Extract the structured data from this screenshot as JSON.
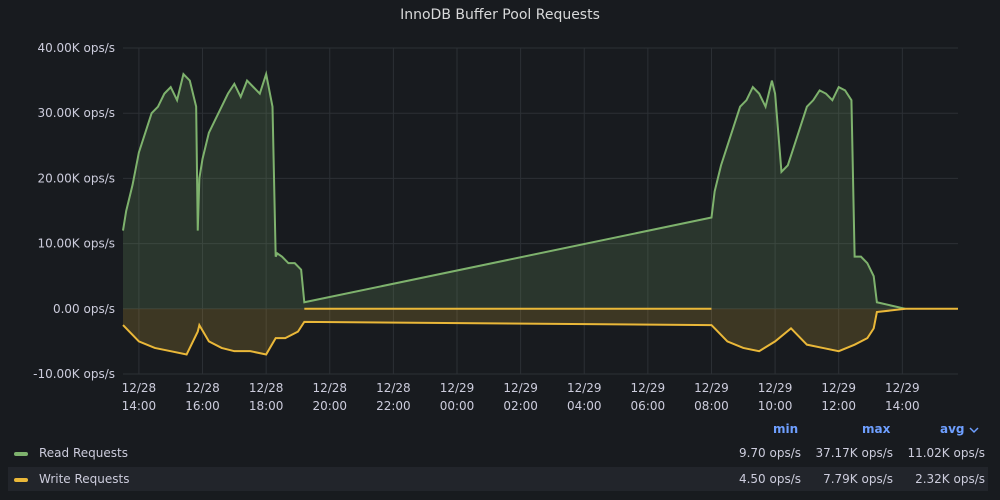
{
  "panel": {
    "title": "InnoDB Buffer Pool Requests"
  },
  "legend": {
    "headers": {
      "min": "min",
      "max": "max",
      "avg": "avg",
      "sort_icon": "chevron-down-icon"
    },
    "rows": [
      {
        "name": "Read Requests",
        "color": "#7eb26d",
        "min": "9.70 ops/s",
        "max": "37.17K ops/s",
        "avg": "11.02K ops/s"
      },
      {
        "name": "Write Requests",
        "color": "#eab839",
        "min": "4.50 ops/s",
        "max": "7.79K ops/s",
        "avg": "2.32K ops/s"
      }
    ]
  },
  "chart_data": {
    "type": "area",
    "title": "InnoDB Buffer Pool Requests",
    "xlabel": "",
    "ylabel": "",
    "ylim": [
      -10000,
      40000
    ],
    "ytick_labels": [
      "40.00K ops/s",
      "30.00K ops/s",
      "20.00K ops/s",
      "10.00K ops/s",
      "0.00 ops/s",
      "-10.00K ops/s"
    ],
    "ytick_values": [
      40000,
      30000,
      20000,
      10000,
      0,
      -10000
    ],
    "xlim": [
      "12/28 13:30",
      "12/29 15:45"
    ],
    "xtick_labels": [
      [
        "12/28",
        "14:00"
      ],
      [
        "12/28",
        "16:00"
      ],
      [
        "12/28",
        "18:00"
      ],
      [
        "12/28",
        "20:00"
      ],
      [
        "12/28",
        "22:00"
      ],
      [
        "12/29",
        "00:00"
      ],
      [
        "12/29",
        "02:00"
      ],
      [
        "12/29",
        "04:00"
      ],
      [
        "12/29",
        "06:00"
      ],
      [
        "12/29",
        "08:00"
      ],
      [
        "12/29",
        "10:00"
      ],
      [
        "12/29",
        "12:00"
      ],
      [
        "12/29",
        "14:00"
      ]
    ],
    "grid": true,
    "x_unit": "hours since 12/28 00:00",
    "series": [
      {
        "name": "Read Requests",
        "color": "#7eb26d",
        "x": [
          13.5,
          13.6,
          13.8,
          14.0,
          14.2,
          14.4,
          14.6,
          14.8,
          15.0,
          15.2,
          15.4,
          15.6,
          15.8,
          15.85,
          15.9,
          16.0,
          16.2,
          16.4,
          16.6,
          16.8,
          17.0,
          17.2,
          17.4,
          17.6,
          17.8,
          18.0,
          18.2,
          18.3,
          18.35,
          18.5,
          18.7,
          18.9,
          19.1,
          19.2,
          32.0,
          32.1,
          32.3,
          32.5,
          32.7,
          32.9,
          33.1,
          33.3,
          33.5,
          33.7,
          33.9,
          34.0,
          34.2,
          34.4,
          34.6,
          34.8,
          35.0,
          35.2,
          35.4,
          35.6,
          35.8,
          36.0,
          36.2,
          36.4,
          36.5,
          36.7,
          36.9,
          37.1,
          37.2,
          38.1
        ],
        "values": [
          12000,
          15000,
          19000,
          24000,
          27000,
          30000,
          31000,
          33000,
          34000,
          32000,
          36000,
          35000,
          31000,
          12000,
          20000,
          23000,
          27000,
          29000,
          31000,
          33000,
          34500,
          32500,
          35000,
          34000,
          33000,
          36000,
          31000,
          8000,
          8500,
          8000,
          7000,
          7000,
          6000,
          1000,
          14000,
          18000,
          22000,
          25000,
          28000,
          31000,
          32000,
          34000,
          33000,
          31000,
          35000,
          33000,
          21000,
          22000,
          25000,
          28000,
          31000,
          32000,
          33500,
          33000,
          32000,
          34000,
          33500,
          32000,
          8000,
          8000,
          7000,
          5000,
          1000,
          0
        ]
      },
      {
        "name": "Write Requests",
        "color": "#eab839",
        "x": [
          13.5,
          13.6,
          14.0,
          14.5,
          15.0,
          15.5,
          15.85,
          15.9,
          16.2,
          16.6,
          17.0,
          17.5,
          18.0,
          18.3,
          18.6,
          19.0,
          19.2,
          32.0,
          32.1,
          32.5,
          33.0,
          33.5,
          34.0,
          34.5,
          35.0,
          35.5,
          36.0,
          36.5,
          36.9,
          37.1,
          37.2,
          38.1
        ],
        "values": [
          -2500,
          -3000,
          -5000,
          -6000,
          -6500,
          -7000,
          -3500,
          -2500,
          -5000,
          -6000,
          -6500,
          -6500,
          -7000,
          -4500,
          -4500,
          -3500,
          -2000,
          -2500,
          -3000,
          -5000,
          -6000,
          -6500,
          -5000,
          -3000,
          -5500,
          -6000,
          -6500,
          -5500,
          -4500,
          -3000,
          -500,
          0
        ]
      }
    ]
  }
}
